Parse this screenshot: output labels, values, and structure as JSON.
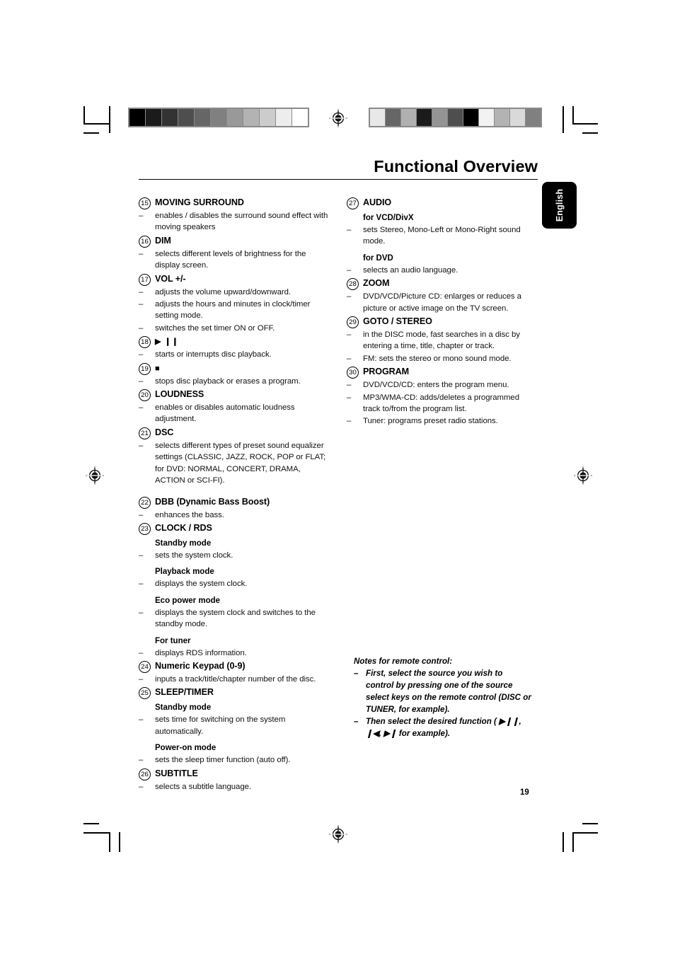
{
  "header": {
    "title": "Functional Overview",
    "language_tab": "English"
  },
  "page_number": "19",
  "left_column": [
    {
      "num": "15",
      "label": "MOVING SURROUND",
      "lines": [
        {
          "type": "dash",
          "text": "enables / disables the surround sound effect with moving speakers"
        }
      ]
    },
    {
      "num": "16",
      "label": "DIM",
      "lines": [
        {
          "type": "dash",
          "text": "selects different levels of brightness for the display screen."
        }
      ]
    },
    {
      "num": "17",
      "label": "VOL +/-",
      "lines": [
        {
          "type": "dash",
          "text": "adjusts the volume upward/downward."
        },
        {
          "type": "dash",
          "text": "adjusts the hours and minutes in clock/timer setting mode."
        },
        {
          "type": "dash",
          "text": "switches the set timer ON or OFF."
        }
      ]
    },
    {
      "num": "18",
      "label": "▶ ❙❙",
      "icon": "play-pause-icon",
      "lines": [
        {
          "type": "dash",
          "text": "starts or interrupts disc playback."
        }
      ]
    },
    {
      "num": "19",
      "label": "■",
      "icon": "stop-icon",
      "lines": [
        {
          "type": "dash",
          "text": "stops disc playback or erases a program."
        }
      ]
    },
    {
      "num": "20",
      "label": "LOUDNESS",
      "lines": [
        {
          "type": "dash",
          "text": "enables or disables automatic loudness adjustment."
        }
      ]
    },
    {
      "num": "21",
      "label": "DSC",
      "lines": [
        {
          "type": "dash",
          "text": "selects different types of preset sound equalizer settings (CLASSIC, JAZZ, ROCK, POP or FLAT; for DVD: NORMAL, CONCERT, DRAMA, ACTION or SCI-FI)."
        }
      ]
    },
    {
      "num": "22",
      "label": "DBB (Dynamic Bass Boost)",
      "spaced_before": true,
      "lines": [
        {
          "type": "dash",
          "text": "enhances the bass."
        }
      ]
    },
    {
      "num": "23",
      "label": "CLOCK / RDS",
      "lines": [
        {
          "type": "submode",
          "text": "Standby mode"
        },
        {
          "type": "dash",
          "text": "sets the system clock."
        },
        {
          "type": "submode",
          "text": "Playback mode"
        },
        {
          "type": "dash",
          "text": "displays the system clock."
        },
        {
          "type": "submode",
          "text": "Eco power mode"
        },
        {
          "type": "dash",
          "text": "displays the system clock and switches to the standby mode."
        },
        {
          "type": "submode",
          "text": "For tuner"
        },
        {
          "type": "dash",
          "text": "displays RDS information."
        }
      ]
    },
    {
      "num": "24",
      "label": "Numeric Keypad (0-9)",
      "lines": [
        {
          "type": "dash",
          "text": "inputs a track/title/chapter number of the disc."
        }
      ]
    },
    {
      "num": "25",
      "label": "SLEEP/TIMER",
      "lines": [
        {
          "type": "submode",
          "text": "Standby mode"
        },
        {
          "type": "dash",
          "text": "sets time for switching on the system automatically."
        },
        {
          "type": "submode",
          "text": "Power-on mode"
        },
        {
          "type": "dash",
          "text": "sets the sleep timer function (auto off)."
        }
      ]
    },
    {
      "num": "26",
      "label": "SUBTITLE",
      "lines": [
        {
          "type": "dash",
          "text": "selects a subtitle language."
        }
      ]
    }
  ],
  "right_column": [
    {
      "num": "27",
      "label": "AUDIO",
      "lines": [
        {
          "type": "submode",
          "text": "for VCD/DivX"
        },
        {
          "type": "dash",
          "text": "sets Stereo, Mono-Left or Mono-Right sound mode."
        },
        {
          "type": "submode",
          "text": "for DVD"
        },
        {
          "type": "dash",
          "text": "selects an audio language."
        }
      ]
    },
    {
      "num": "28",
      "label": "ZOOM",
      "lines": [
        {
          "type": "dash",
          "text": "DVD/VCD/Picture CD: enlarges or reduces a picture or active image on the TV screen."
        }
      ]
    },
    {
      "num": "29",
      "label": "GOTO / STEREO",
      "lines": [
        {
          "type": "dash",
          "text": "in the DISC mode, fast searches in a disc by entering a time, title, chapter or track."
        },
        {
          "type": "dash",
          "text": "FM: sets the stereo or mono sound mode."
        }
      ]
    },
    {
      "num": "30",
      "label": "PROGRAM",
      "lines": [
        {
          "type": "dash",
          "text": "DVD/VCD/CD: enters the program menu."
        },
        {
          "type": "dash",
          "text": "MP3/WMA-CD: adds/deletes a programmed track to/from the program list."
        },
        {
          "type": "dash",
          "text": "Tuner: programs preset radio stations."
        }
      ]
    }
  ],
  "notes": {
    "title": "Notes for remote control:",
    "items": [
      "First, select the source you wish to control by pressing one of the source select keys on the remote control (DISC or TUNER, for example).",
      "Then select the desired function ( ▶❙❙, ❙◀, ▶❙ for example)."
    ],
    "dash": "–"
  },
  "print_marks": {
    "wedge_left": [
      "#000000",
      "#1b1b1b",
      "#333333",
      "#4e4e4e",
      "#666666",
      "#808080",
      "#999999",
      "#b3b3b3",
      "#cccccc",
      "#ededed",
      "#ffffff"
    ],
    "wedge_right": [
      "#e8e8e8",
      "#666666",
      "#b0b0b0",
      "#1b1b1b",
      "#949494",
      "#4e4e4e",
      "#000000",
      "#f2f2f2",
      "#b3b3b3",
      "#d9d9d9",
      "#808080"
    ]
  }
}
